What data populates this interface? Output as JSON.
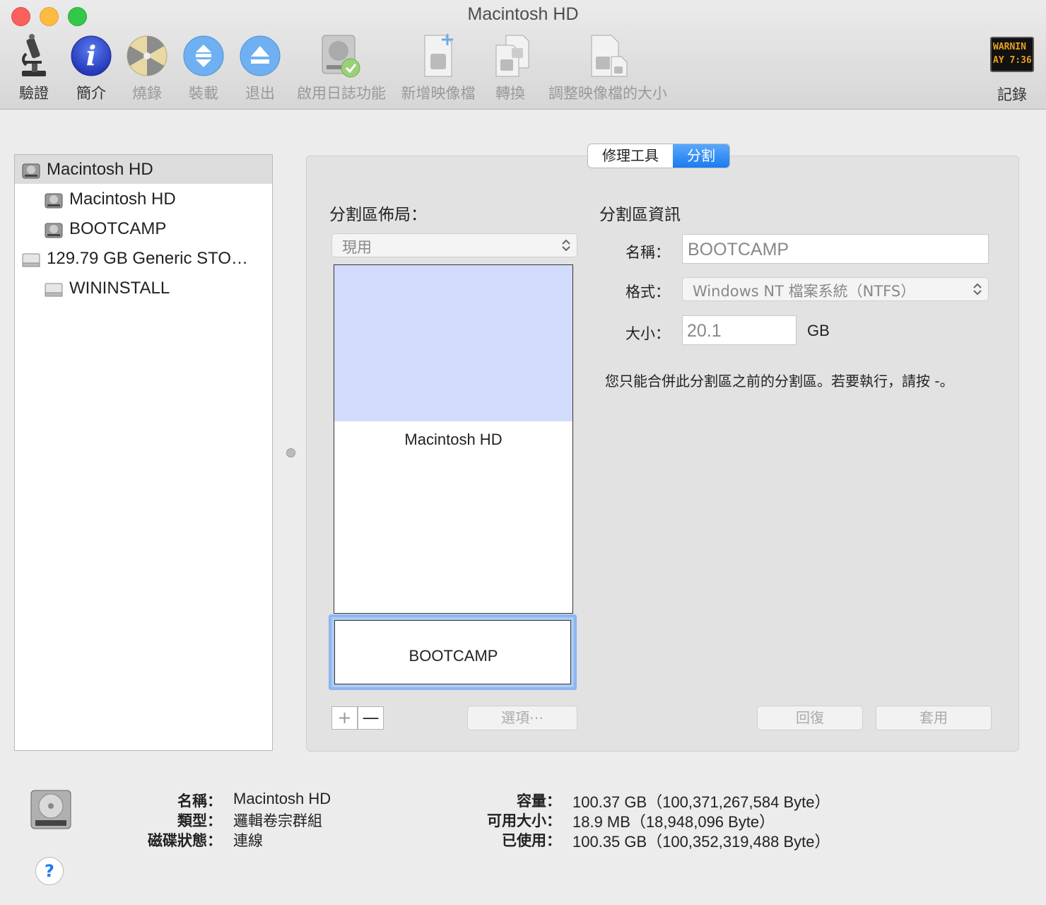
{
  "window": {
    "title": "Macintosh HD"
  },
  "toolbar": {
    "verify": "驗證",
    "info": "簡介",
    "burn": "燒錄",
    "mount": "裝載",
    "eject": "退出",
    "journal": "啟用日誌功能",
    "new_image": "新增映像檔",
    "convert": "轉換",
    "resize_image": "調整映像檔的大小",
    "log": "記錄",
    "log_display_line1": "WARNIN",
    "log_display_line2": "AY 7:36"
  },
  "sidebar": {
    "items": [
      {
        "label": "Macintosh HD",
        "icon": "internal-disk-icon",
        "level": 0,
        "selected": true
      },
      {
        "label": "Macintosh HD",
        "icon": "internal-disk-icon",
        "level": 1
      },
      {
        "label": "BOOTCAMP",
        "icon": "internal-disk-icon",
        "level": 1
      },
      {
        "label": "129.79 GB Generic STO…",
        "icon": "external-disk-icon",
        "level": 0
      },
      {
        "label": "WININSTALL",
        "icon": "external-disk-icon",
        "level": 1
      }
    ]
  },
  "tabs": {
    "first_aid": "修理工具",
    "partition": "分割",
    "active": "partition"
  },
  "layout_section": {
    "heading": "分割區佈局：",
    "scheme": "現用",
    "partitions": [
      {
        "name": "Macintosh HD",
        "used_fraction": 0.45
      },
      {
        "name": "BOOTCAMP"
      }
    ]
  },
  "info_section": {
    "heading": "分割區資訊",
    "name_label": "名稱：",
    "name_value": "BOOTCAMP",
    "format_label": "格式：",
    "format_value": "Windows NT 檔案系統（NTFS）",
    "size_label": "大小：",
    "size_value": "20.1",
    "size_unit": "GB",
    "message": "您只能合併此分割區之前的分割區。若要執行，請按 -。"
  },
  "buttons": {
    "add": "+",
    "remove": "—",
    "options": "選項⋯",
    "revert": "回復",
    "apply": "套用"
  },
  "footer": {
    "name_label": "名稱：",
    "name_value": "Macintosh HD",
    "type_label": "類型：",
    "type_value": "邏輯卷宗群組",
    "status_label": "磁碟狀態：",
    "status_value": "連線",
    "capacity_label": "容量：",
    "capacity_value": "100.37 GB（100,371,267,584 Byte）",
    "available_label": "可用大小：",
    "available_value": "18.9 MB（18,948,096 Byte）",
    "used_label": "已使用：",
    "used_value": "100.35 GB（100,352,319,488 Byte）"
  },
  "help": {
    "label": "?"
  },
  "colors": {
    "accent": "#1b7bf1",
    "layout_fill": "#d2dbfb",
    "selection_ring": "#8db6f1"
  }
}
